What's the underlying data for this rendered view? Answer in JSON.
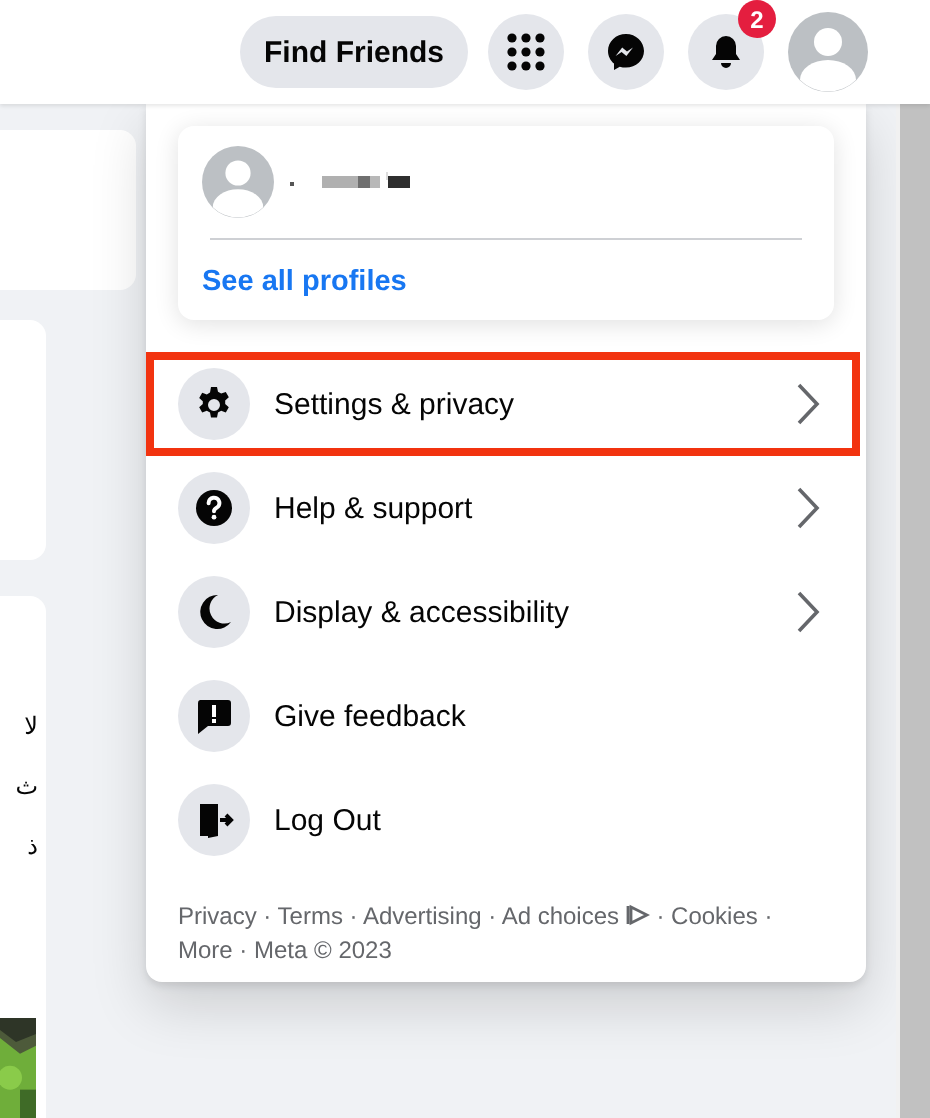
{
  "top_bar": {
    "find_friends": "Find Friends",
    "notification_count": "2"
  },
  "background_texts": [
    "لا",
    "ث",
    "ذ"
  ],
  "menu": {
    "profile": {
      "see_all": "See all profiles"
    },
    "items": [
      {
        "kind": "gear",
        "label": "Settings & privacy",
        "submenu": true,
        "highlighted": true
      },
      {
        "kind": "help",
        "label": "Help & support",
        "submenu": true,
        "highlighted": false
      },
      {
        "kind": "moon",
        "label": "Display & accessibility",
        "submenu": true,
        "highlighted": false
      },
      {
        "kind": "feedback",
        "label": "Give feedback",
        "submenu": false,
        "highlighted": false
      },
      {
        "kind": "logout",
        "label": "Log Out",
        "submenu": false,
        "highlighted": false
      }
    ],
    "footer": {
      "before_icon": "Privacy · Terms · Advertising · Ad choices",
      "after_icon": "· Cookies · More · Meta © 2023"
    }
  }
}
